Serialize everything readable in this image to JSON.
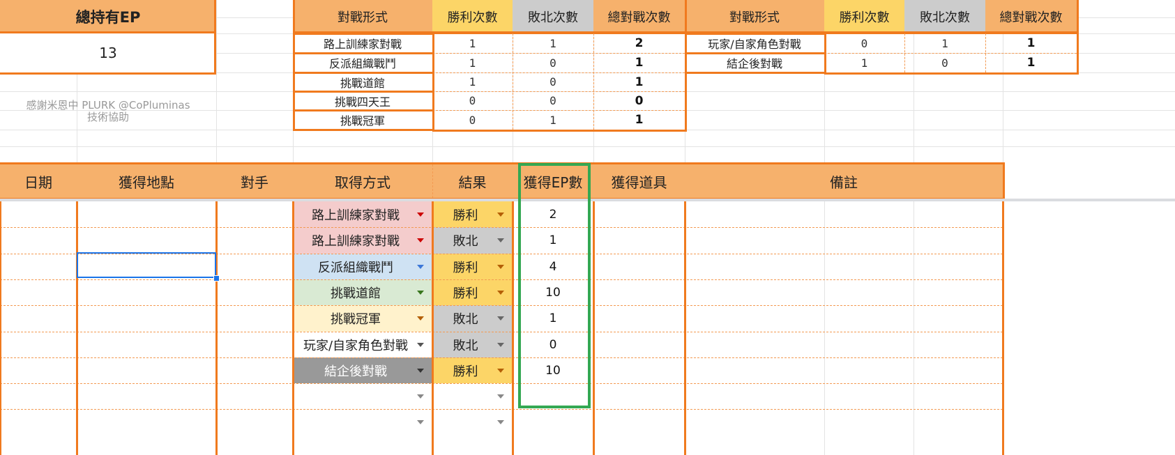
{
  "summary": {
    "ep_label": "總持有EP",
    "ep_value": "13",
    "credit_line1": "感謝米恩中 PLURK @CoPluminas",
    "credit_line2": "技術協助"
  },
  "stats_left": {
    "headers": [
      "對戰形式",
      "勝利次數",
      "敗北次數",
      "總對戰次數"
    ],
    "rows": [
      {
        "type": "路上訓練家對戰",
        "win": "1",
        "loss": "1",
        "total": "2"
      },
      {
        "type": "反派組織戰鬥",
        "win": "1",
        "loss": "0",
        "total": "1"
      },
      {
        "type": "挑戰道館",
        "win": "1",
        "loss": "0",
        "total": "1"
      },
      {
        "type": "挑戰四天王",
        "win": "0",
        "loss": "0",
        "total": "0"
      },
      {
        "type": "挑戰冠軍",
        "win": "0",
        "loss": "1",
        "total": "1"
      }
    ]
  },
  "stats_right": {
    "headers": [
      "對戰形式",
      "勝利次數",
      "敗北次數",
      "總對戰次數"
    ],
    "rows": [
      {
        "type": "玩家/自家角色對戰",
        "win": "0",
        "loss": "1",
        "total": "1"
      },
      {
        "type": "結企後對戰",
        "win": "1",
        "loss": "0",
        "total": "1"
      }
    ]
  },
  "log": {
    "headers": {
      "date": "日期",
      "location": "獲得地點",
      "opponent": "對手",
      "method": "取得方式",
      "result": "結果",
      "ep": "獲得EP數",
      "items": "獲得道具",
      "notes": "備註"
    },
    "rows": [
      {
        "method": "路上訓練家對戰",
        "method_color": "#f4cccc",
        "arrow_color": "#cc0000",
        "result": "勝利",
        "result_color": "#fcd567",
        "ep": "2"
      },
      {
        "method": "路上訓練家對戰",
        "method_color": "#f4cccc",
        "arrow_color": "#cc0000",
        "result": "敗北",
        "result_color": "#cccccc",
        "ep": "1"
      },
      {
        "method": "反派組織戰鬥",
        "method_color": "#cfe2f3",
        "arrow_color": "#3c78d8",
        "result": "勝利",
        "result_color": "#fcd567",
        "ep": "4"
      },
      {
        "method": "挑戰道館",
        "method_color": "#d9ead3",
        "arrow_color": "#38761d",
        "result": "勝利",
        "result_color": "#fcd567",
        "ep": "10"
      },
      {
        "method": "挑戰冠軍",
        "method_color": "#fff2cc",
        "arrow_color": "#b45f06",
        "result": "敗北",
        "result_color": "#cccccc",
        "ep": "1"
      },
      {
        "method": "玩家/自家角色對戰",
        "method_color": "#ffffff",
        "arrow_color": "#555555",
        "result": "敗北",
        "result_color": "#cccccc",
        "ep": "0"
      },
      {
        "method": "結企後對戰",
        "method_color": "#999999",
        "arrow_color": "#333333",
        "result": "勝利",
        "result_color": "#fcd567",
        "ep": "10"
      }
    ]
  },
  "colors": {
    "accent_orange": "#f07a1e",
    "header_orange": "#f6b16c",
    "win_yellow": "#fcd567",
    "loss_gray": "#cccccc",
    "ep_green": "#34a853",
    "selection_blue": "#1a73e8"
  }
}
